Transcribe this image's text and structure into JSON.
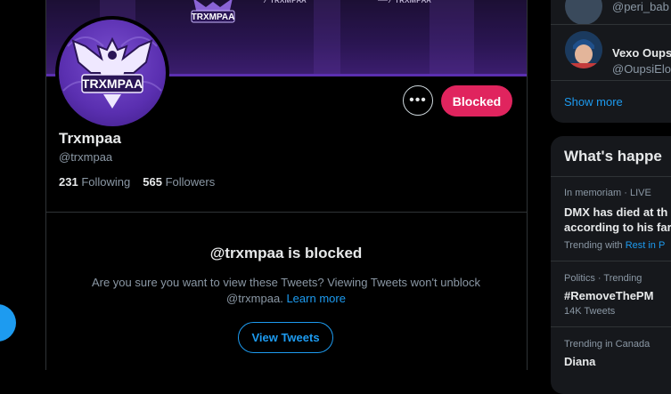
{
  "profile": {
    "banner_logo_text": "TRXMPAA",
    "avatar_text": "TRXMPAA",
    "name": "Trxmpaa",
    "handle": "@trxmpaa",
    "following_count": "231",
    "following_label": "Following",
    "followers_count": "565",
    "followers_label": "Followers",
    "more_label": "•••",
    "blocked_label": "Blocked"
  },
  "blocked_notice": {
    "title": "@trxmpaa is blocked",
    "message": "Are you sure you want to view these Tweets? Viewing Tweets won't unblock @trxmpaa.",
    "learn_more": "Learn more",
    "view_button": "View Tweets"
  },
  "who_to_follow": {
    "items": [
      {
        "name": "",
        "handle": "@peri_bab"
      },
      {
        "name": "Vexo Oups",
        "handle": "@OupsiElo"
      }
    ],
    "show_more": "Show more"
  },
  "trends": {
    "header": "What's happe",
    "items": [
      {
        "meta": "In memoriam · LIVE",
        "title_line1": "DMX has died at th",
        "title_line2": "according to his far",
        "extra_prefix": "Trending with",
        "extra_link": "Rest in P"
      },
      {
        "meta": "Politics · Trending",
        "title_line1": "#RemoveThePM",
        "count": "14K Tweets"
      },
      {
        "meta": "Trending in Canada",
        "title_line1": "Diana"
      }
    ]
  },
  "colors": {
    "accent": "#1d9bf0",
    "blocked": "#e0245e",
    "banner_purple": "#5b2fb0"
  }
}
